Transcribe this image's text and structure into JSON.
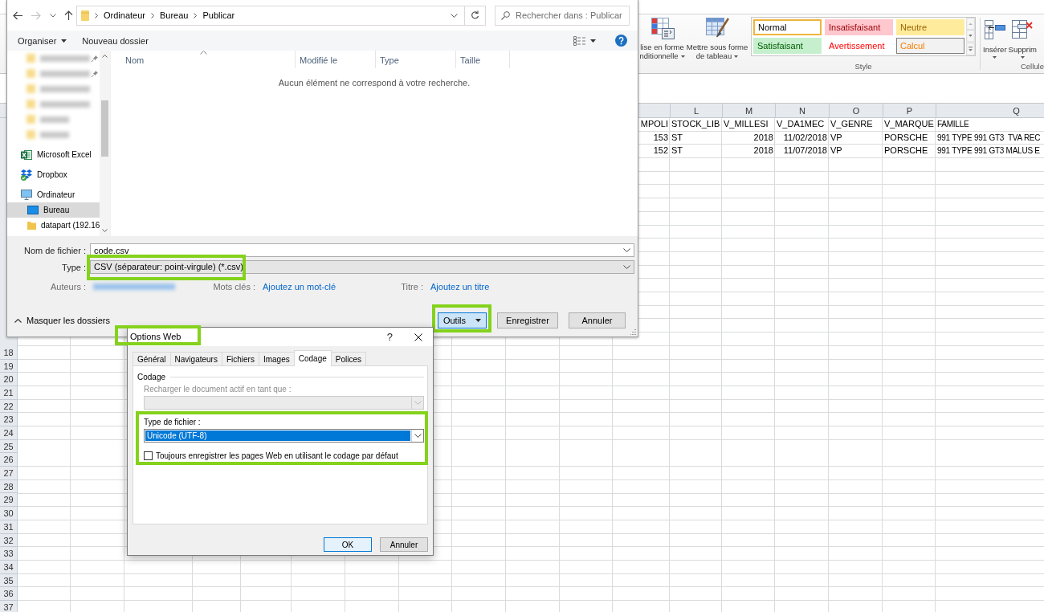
{
  "save_dialog": {
    "address": {
      "path": [
        "Ordinateur",
        "Bureau",
        "Publicar"
      ]
    },
    "search": {
      "placeholder": "Rechercher dans : Publicar"
    },
    "toolbar": {
      "organize": "Organiser",
      "new_folder": "Nouveau dossier"
    },
    "nav_pane": {
      "blurred_items": [
        {
          "pinned": true
        },
        {
          "pinned": true
        },
        {
          "pinned": false
        },
        {
          "pinned": false
        },
        {
          "pinned": false
        },
        {
          "pinned": false
        }
      ],
      "items": [
        {
          "label": "Microsoft Excel",
          "kind": "application",
          "selected": false
        },
        {
          "label": "Dropbox",
          "kind": "cloud-storage",
          "selected": false
        },
        {
          "label": "Ordinateur",
          "kind": "computer",
          "selected": false,
          "children": [
            {
              "label": "Bureau",
              "kind": "desktop",
              "selected": true
            },
            {
              "label": "datapart (192.16",
              "kind": "network-folder",
              "selected": false
            }
          ]
        }
      ]
    },
    "file_list": {
      "columns": [
        {
          "label": "Nom",
          "sorted": true
        },
        {
          "label": "Modifié le",
          "sorted": false
        },
        {
          "label": "Type",
          "sorted": false
        },
        {
          "label": "Taille",
          "sorted": false
        }
      ],
      "empty_message": "Aucun élément ne correspond à votre recherche."
    },
    "file_name": {
      "label": "Nom de fichier :",
      "value": "code.csv"
    },
    "file_type": {
      "label": "Type :",
      "value": "CSV (séparateur: point-virgule) (*.csv)",
      "highlighted": true
    },
    "metadata": [
      {
        "label": "Auteurs :",
        "kind": "blurred"
      },
      {
        "label": "Mots clés :",
        "kind": "link",
        "link": "Ajoutez un mot-clé"
      },
      {
        "label": "Titre :",
        "kind": "link",
        "link": "Ajoutez un titre"
      }
    ],
    "hide_folders": "Masquer les dossiers",
    "buttons": [
      {
        "label": "Outils",
        "kind": "menu",
        "focused": true,
        "highlighted": true
      },
      {
        "label": "Enregistrer",
        "kind": "save",
        "focused": false,
        "highlighted": false
      },
      {
        "label": "Annuler",
        "kind": "cancel",
        "focused": false,
        "highlighted": false
      }
    ]
  },
  "options_dialog": {
    "title": "Options Web",
    "title_highlighted": true,
    "help": "?",
    "tabs": [
      {
        "label": "Général",
        "selected": false
      },
      {
        "label": "Navigateurs",
        "selected": false
      },
      {
        "label": "Fichiers",
        "selected": false
      },
      {
        "label": "Images",
        "selected": false
      },
      {
        "label": "Codage",
        "selected": true
      },
      {
        "label": "Polices",
        "selected": false
      }
    ],
    "group_label": "Codage",
    "reload": {
      "label": "Recharger le document actif en tant que :",
      "disabled": true
    },
    "encoding": {
      "highlighted": true,
      "label": "Type de fichier :",
      "value": "Unicode (UTF-8)",
      "always_default": {
        "label": "Toujours enregistrer les pages Web en utilisant le codage par défaut",
        "checked": false
      }
    },
    "buttons": [
      {
        "label": "OK",
        "default": true
      },
      {
        "label": "Annuler",
        "default": false
      }
    ]
  },
  "ribbon": {
    "commands": [
      {
        "kind": "conditional-format",
        "lines": [
          "lise en forme",
          "nditionnelle"
        ],
        "dropdown": true
      },
      {
        "kind": "format-as-table",
        "lines": [
          "Mettre sous forme",
          "de tableau"
        ],
        "dropdown": true
      }
    ],
    "styles": [
      {
        "label": "Normal",
        "kind": "normal",
        "selected": true
      },
      {
        "label": "Insatisfaisant",
        "kind": "bad",
        "selected": false
      },
      {
        "label": "Neutre",
        "kind": "neutral",
        "selected": false
      },
      {
        "label": "Satisfaisant",
        "kind": "good",
        "selected": false
      },
      {
        "label": "Avertissement",
        "kind": "warning",
        "selected": false
      },
      {
        "label": "Calcul",
        "kind": "calculation",
        "selected": false
      }
    ],
    "style_group_label": "Style",
    "cell_commands": [
      {
        "kind": "insert",
        "label": "Insérer",
        "dropdown": true
      },
      {
        "kind": "delete",
        "label": "Supprim",
        "dropdown": true
      }
    ],
    "cells_group_label": "Cellule"
  },
  "sheet": {
    "column_letters": [
      "L",
      "M",
      "N",
      "O",
      "P",
      "Q"
    ],
    "rows": [
      {
        "cells": [
          {
            "text": "MPOLI",
            "kind": "text"
          },
          {
            "text": "STOCK_LIB",
            "kind": "text"
          },
          {
            "text": "V_MILLESI",
            "kind": "text"
          },
          {
            "text": "V_DA1MEC",
            "kind": "text"
          },
          {
            "text": "V_GENRE",
            "kind": "text"
          },
          {
            "text": "V_MARQUE",
            "kind": "text"
          },
          {
            "text": "FAMILLE",
            "kind": "text"
          }
        ]
      },
      {
        "cells": [
          {
            "text": "153",
            "kind": "number"
          },
          {
            "text": "ST",
            "kind": "text"
          },
          {
            "text": "2018",
            "kind": "number"
          },
          {
            "text": "11/02/2018",
            "kind": "number"
          },
          {
            "text": "VP",
            "kind": "text"
          },
          {
            "text": "PORSCHE",
            "kind": "text"
          },
          {
            "text": "991 TYPE 991 GT3  TVA REC",
            "kind": "text"
          }
        ]
      },
      {
        "cells": [
          {
            "text": "152",
            "kind": "number"
          },
          {
            "text": "ST",
            "kind": "text"
          },
          {
            "text": "2018",
            "kind": "number"
          },
          {
            "text": "11/07/2018",
            "kind": "number"
          },
          {
            "text": "VP",
            "kind": "text"
          },
          {
            "text": "PORSCHE",
            "kind": "text"
          },
          {
            "text": "991 TYPE 991 GT3 MALUS E",
            "kind": "text"
          }
        ]
      }
    ],
    "row_numbers": [
      "18",
      "19",
      "20",
      "21",
      "22",
      "23",
      "24",
      "25",
      "26",
      "27",
      "28",
      "29",
      "30",
      "31",
      "32",
      "33",
      "34",
      "35",
      "36",
      "37"
    ]
  }
}
